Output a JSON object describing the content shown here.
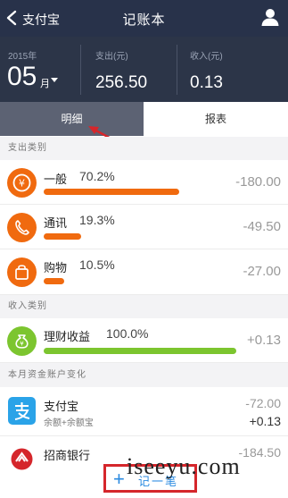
{
  "header": {
    "back_label": "支付宝",
    "title": "记账本"
  },
  "summary": {
    "year": "2015年",
    "month": "05",
    "month_unit": "月",
    "expense_label": "支出(元)",
    "expense_value": "256.50",
    "income_label": "收入(元)",
    "income_value": "0.13"
  },
  "tabs": {
    "detail": "明细",
    "report": "报表"
  },
  "expense_section": {
    "title": "支出类别",
    "items": [
      {
        "name": "一般",
        "percent": "70.2%",
        "amount": "-180.00",
        "share": 0.702,
        "icon": "yen-icon",
        "color": "#f06a0f"
      },
      {
        "name": "通讯",
        "percent": "19.3%",
        "amount": "-49.50",
        "share": 0.193,
        "icon": "phone-icon",
        "color": "#f06a0f"
      },
      {
        "name": "购物",
        "percent": "10.5%",
        "amount": "-27.00",
        "share": 0.105,
        "icon": "shopping-bag-icon",
        "color": "#f06a0f"
      }
    ]
  },
  "income_section": {
    "title": "收入类别",
    "items": [
      {
        "name": "理财收益",
        "percent": "100.0%",
        "amount": "+0.13",
        "share": 1.0,
        "icon": "money-bag-icon",
        "color": "#7cc52f"
      }
    ]
  },
  "accounts_section": {
    "title": "本月资金账户变化",
    "items": [
      {
        "name": "支付宝",
        "sub": "余额+余额宝",
        "amount_1": "-72.00",
        "amount_2": "+0.13",
        "icon": "alipay-icon"
      },
      {
        "name": "招商银行",
        "amount_1": "-184.50",
        "icon": "cmb-bank-icon"
      }
    ]
  },
  "footer": {
    "plus": "+",
    "record_label": "记一笔"
  },
  "watermark": "iseeyu.com",
  "colors": {
    "header_bg": "#28324a",
    "summary_bg": "#2c3548",
    "expense_accent": "#f06a0f",
    "income_accent": "#7cc52f",
    "alipay_blue": "#2aa3e8",
    "highlight_red": "#d5262b"
  }
}
